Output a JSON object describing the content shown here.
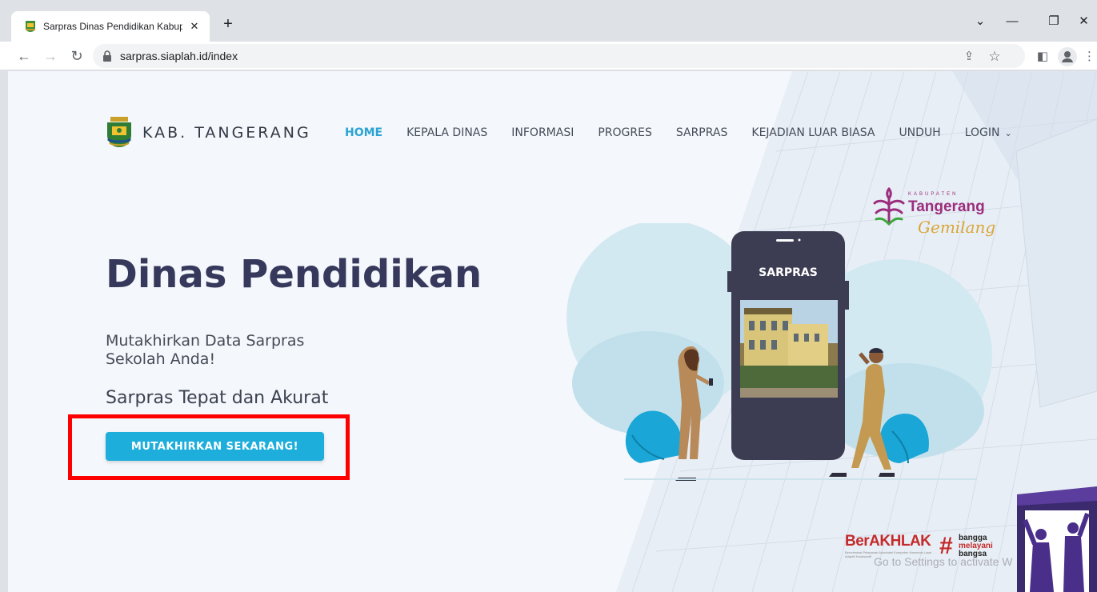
{
  "browser": {
    "tab_title": "Sarpras Dinas Pendidikan Kabup",
    "tab_close": "✕",
    "new_tab": "+",
    "url": "sarpras.siaplah.id/index",
    "controls": {
      "dropdown": "⌄",
      "minimize": "—",
      "restore": "❐",
      "close": "✕"
    },
    "nav": {
      "back": "←",
      "forward": "→",
      "reload": "↻"
    },
    "toolbar_icons": {
      "share": "⇪",
      "bookmark": "☆",
      "sidepanel": "◧",
      "menu": "⋮"
    }
  },
  "site": {
    "name": "KAB. TANGERANG",
    "nav_items": [
      {
        "label": "HOME",
        "active": true
      },
      {
        "label": "KEPALA DINAS"
      },
      {
        "label": "INFORMASI"
      },
      {
        "label": "PROGRES"
      },
      {
        "label": "SARPRAS"
      },
      {
        "label": "KEJADIAN LUAR BIASA"
      },
      {
        "label": "UNDUH"
      },
      {
        "label": "LOGIN",
        "dropdown": "⌄"
      }
    ]
  },
  "hero": {
    "title": "Dinas Pendidikan",
    "subtitle": "Mutakhirkan Data Sarpras Sekolah Anda!",
    "tagline": "Sarpras Tepat dan Akurat",
    "cta_label": "MUTAKHIRKAN SEKARANG!"
  },
  "illustration": {
    "phone_label": "SARPRAS"
  },
  "branding": {
    "kabupaten": "KABUPATEN",
    "tangerang": "Tangerang",
    "gemilang": "Gemilang",
    "berakhlak": "BerAKHLAK",
    "berakhlak_small": "Berorientasi Pelayanan Akuntabel Kompeten Harmonis Loyal Adaptif Kolaboratif",
    "hashtag": "#",
    "bangga_1": "bangga",
    "bangga_2": "melayani",
    "bangga_3": "bangsa"
  },
  "watermark": "Go to Settings to activate W",
  "colors": {
    "accent": "#1eaedb",
    "active_nav": "#2aa4d4",
    "title": "#37395c",
    "highlight": "#ff0000"
  }
}
